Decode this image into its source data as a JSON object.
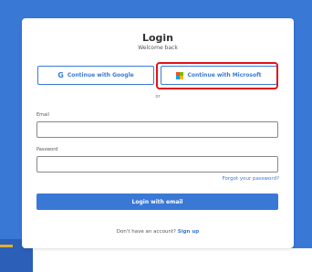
{
  "login": {
    "title": "Login",
    "subtitle": "Welcome back"
  },
  "oauth": {
    "google_label": "Continue with Google",
    "microsoft_label": "Continue with Microsoft",
    "google_icon": "google-icon",
    "microsoft_icon": "microsoft-icon"
  },
  "divider": {
    "text": "or"
  },
  "form": {
    "email_label": "Email",
    "email_value": "",
    "password_label": "Password",
    "password_value": "",
    "forgot_label": "Forgot your password?",
    "submit_label": "Login with email"
  },
  "footer": {
    "prompt": "Don't have an account?",
    "signup_label": "Sign up"
  },
  "colors": {
    "background": "#3a78d6",
    "accent": "#3a78d6",
    "highlight": "#e0141c"
  }
}
